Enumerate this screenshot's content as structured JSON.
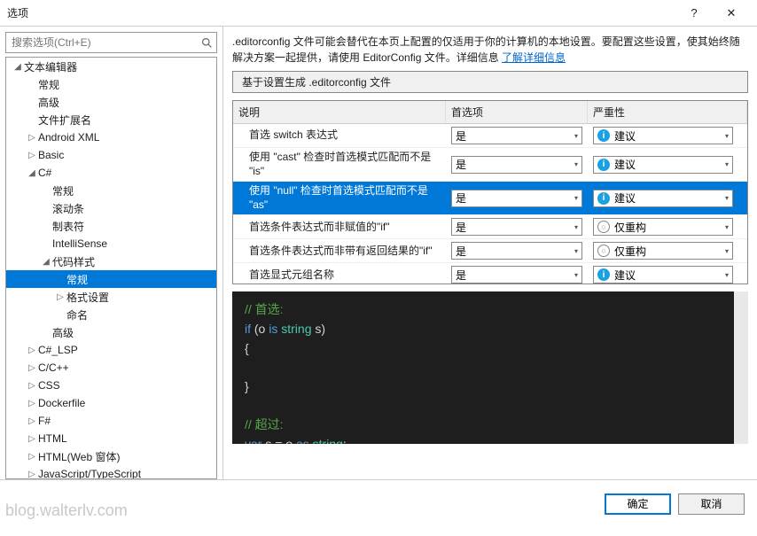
{
  "window": {
    "title": "选项",
    "help": "?",
    "close": "✕"
  },
  "search": {
    "placeholder": "搜索选项(Ctrl+E)"
  },
  "tree": [
    {
      "label": "文本编辑器",
      "ind": 0,
      "exp": "down"
    },
    {
      "label": "常规",
      "ind": 1,
      "exp": "none"
    },
    {
      "label": "高级",
      "ind": 1,
      "exp": "none"
    },
    {
      "label": "文件扩展名",
      "ind": 1,
      "exp": "none"
    },
    {
      "label": "Android XML",
      "ind": 1,
      "exp": "right"
    },
    {
      "label": "Basic",
      "ind": 1,
      "exp": "right"
    },
    {
      "label": "C#",
      "ind": 1,
      "exp": "down"
    },
    {
      "label": "常规",
      "ind": 2,
      "exp": "none"
    },
    {
      "label": "滚动条",
      "ind": 2,
      "exp": "none"
    },
    {
      "label": "制表符",
      "ind": 2,
      "exp": "none"
    },
    {
      "label": "IntelliSense",
      "ind": 2,
      "exp": "none"
    },
    {
      "label": "代码样式",
      "ind": 2,
      "exp": "down"
    },
    {
      "label": "常规",
      "ind": 3,
      "exp": "none",
      "sel": true
    },
    {
      "label": "格式设置",
      "ind": 3,
      "exp": "right"
    },
    {
      "label": "命名",
      "ind": 3,
      "exp": "none"
    },
    {
      "label": "高级",
      "ind": 2,
      "exp": "none"
    },
    {
      "label": "C#_LSP",
      "ind": 1,
      "exp": "right"
    },
    {
      "label": "C/C++",
      "ind": 1,
      "exp": "right"
    },
    {
      "label": "CSS",
      "ind": 1,
      "exp": "right"
    },
    {
      "label": "Dockerfile",
      "ind": 1,
      "exp": "right"
    },
    {
      "label": "F#",
      "ind": 1,
      "exp": "right"
    },
    {
      "label": "HTML",
      "ind": 1,
      "exp": "right"
    },
    {
      "label": "HTML(Web 窗体)",
      "ind": 1,
      "exp": "right"
    },
    {
      "label": "JavaScript/TypeScript",
      "ind": 1,
      "exp": "right"
    }
  ],
  "desc": {
    "text": ".editorconfig 文件可能会替代在本页上配置的仅适用于你的计算机的本地设置。要配置这些设置，使其始终随解决方案一起提供，请使用 EditorConfig 文件。详细信息   ",
    "link": "了解详细信息"
  },
  "generate_button": "基于设置生成 .editorconfig 文件",
  "headers": {
    "desc": "说明",
    "pref": "首选项",
    "sev": "严重性"
  },
  "sev": {
    "suggest": "建议",
    "refactor": "仅重构"
  },
  "yes": "是",
  "rows": [
    {
      "desc": "首选 switch 表达式",
      "pref": "是",
      "sev": "suggest"
    },
    {
      "desc": "使用 \"cast\" 检查时首选模式匹配而不是 \"is\"",
      "pref": "是",
      "sev": "suggest"
    },
    {
      "desc": "使用 \"null\" 检查时首选模式匹配而不是 \"as\"",
      "pref": "是",
      "sev": "suggest",
      "sel": true
    },
    {
      "desc": "首选条件表达式而非赋值的\"if\"",
      "pref": "是",
      "sev": "refactor"
    },
    {
      "desc": "首选条件表达式而非带有返回结果的\"if\"",
      "pref": "是",
      "sev": "refactor"
    },
    {
      "desc": "首选显式元组名称",
      "pref": "是",
      "sev": "suggest"
    }
  ],
  "code": {
    "c1": "// 首选:",
    "l2a": "if",
    "l2b": " (o ",
    "l2c": "is",
    "l2d": " ",
    "l2e": "string",
    "l2f": " s)",
    "l3": "{",
    "l4": "}",
    "c2": "// 超过:",
    "l6a": "var",
    "l6b": " s = o ",
    "l6c": "as",
    "l6d": " ",
    "l6e": "string",
    "l6f": ";"
  },
  "buttons": {
    "ok": "确定",
    "cancel": "取消"
  },
  "watermark": "blog.walterlv.com"
}
